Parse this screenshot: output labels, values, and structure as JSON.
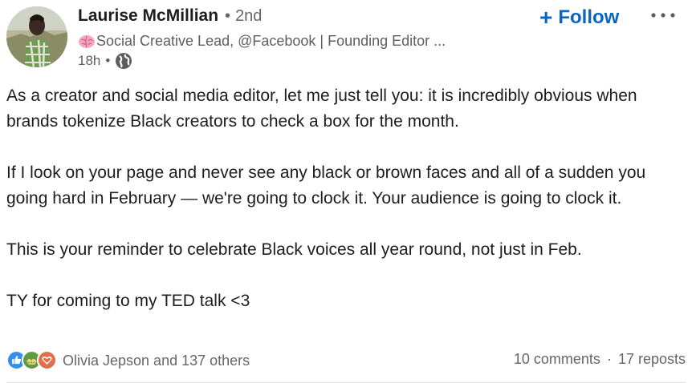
{
  "author": {
    "name": "Laurise McMillian",
    "connection_degree": "2nd",
    "headline": "Social Creative Lead, @Facebook | Founding Editor ...",
    "posted_ago": "18h",
    "visibility_icon": "globe-icon",
    "headline_icon": "brain-icon"
  },
  "actions": {
    "follow_label": "Follow",
    "follow_icon": "plus-icon",
    "more_icon": "ellipsis-icon"
  },
  "post": {
    "paragraphs": [
      "As a creator and social media editor, let me just tell you: it is incredibly obvious when brands tokenize Black creators to check a box for the month.",
      "If I look on your page and never see any black or brown faces and all of a sudden you going hard in February — we're going to clock it. Your audience is going to clock it.",
      "This is your reminder to celebrate Black voices all year round, not just in Feb.",
      "TY for coming to my TED talk <3"
    ]
  },
  "social": {
    "reaction_icons": [
      "like-icon",
      "support-icon",
      "love-icon"
    ],
    "reactions_text": "Olivia Jepson and 137 others",
    "comments": "10 comments",
    "reposts": "17 reposts"
  },
  "colors": {
    "accent": "#0a66c2",
    "text": "#1d1d1d",
    "muted": "#666666",
    "like": "#378fe9",
    "support": "#5f9b41",
    "love": "#df704d"
  }
}
